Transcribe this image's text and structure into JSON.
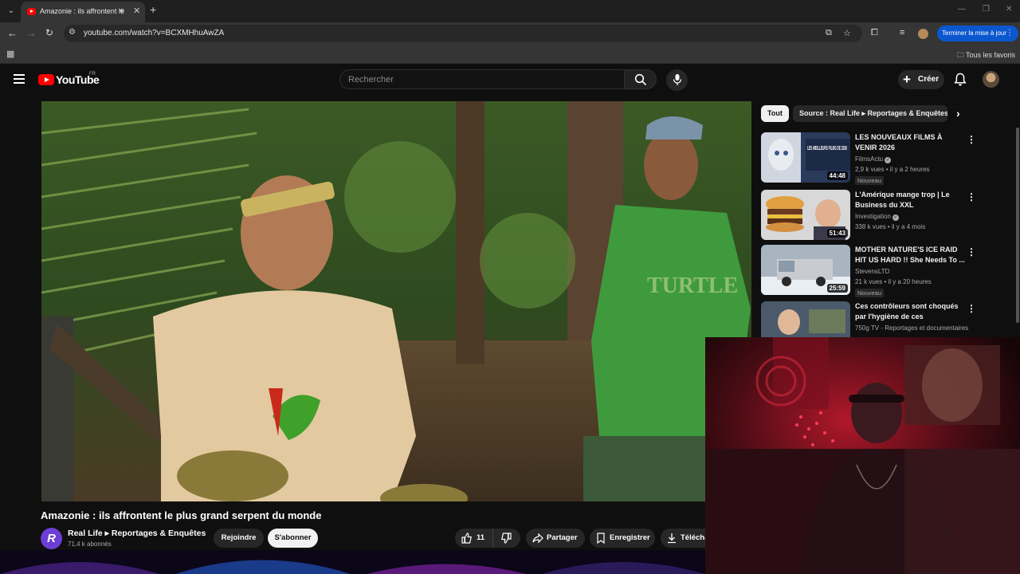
{
  "browser": {
    "tab_title": "Amazonie : ils affrontent le",
    "url": "youtube.com/watch?v=BCXMHhuAwZA",
    "update_label": "Terminer la mise à jour",
    "bookmarks_label": "Tous les favoris"
  },
  "header": {
    "logo_text": "YouTube",
    "country_code": "FR",
    "search_placeholder": "Rechercher",
    "create_label": "Créer"
  },
  "video": {
    "title": "Amazonie : ils affrontent le plus grand serpent du monde",
    "channel_initial": "R",
    "channel_name": "Real Life ▸ Reportages & Enquêtes",
    "subscribers": "71,4 k abonnés",
    "join_label": "Rejoindre",
    "subscribe_label": "S'abonner",
    "like_count": "11",
    "share_label": "Partager",
    "save_label": "Enregistrer",
    "download_label": "Télécharger"
  },
  "sidebar": {
    "chips": [
      {
        "label": "Tout",
        "active": true
      },
      {
        "label": "Source : Real Life ▸ Reportages & Enquêtes",
        "active": false
      }
    ],
    "recommendations": [
      {
        "title": "LES NOUVEAUX FILMS À VENIR 2026",
        "channel": "FilmsActu",
        "verified": true,
        "views": "2,9 k vues",
        "age": "il y a 2 heures",
        "duration": "44:48",
        "badge": "Nouveau"
      },
      {
        "title": "L'Amérique mange trop | Le Business du XXL",
        "channel": "Investigation",
        "verified": true,
        "views": "338 k vues",
        "age": "il y a 4 mois",
        "duration": "51:43",
        "badge": ""
      },
      {
        "title": "MOTHER NATURE'S ICE RAID HIT US HARD !! She Needs To ...",
        "channel": "StevensLTD",
        "verified": false,
        "views": "21 k vues",
        "age": "il y a 20 heures",
        "duration": "25:59",
        "badge": "Nouveau"
      },
      {
        "title": "Ces contrôleurs sont choqués par l'hygiène de ces restaurant...",
        "channel": "750g TV - Reportages et documentaires",
        "verified": false,
        "views": "",
        "age": "",
        "duration": "",
        "badge": ""
      }
    ]
  },
  "thumb_text": {
    "films_overlay": "LES MEILLEURS FILMS DE 2026"
  }
}
